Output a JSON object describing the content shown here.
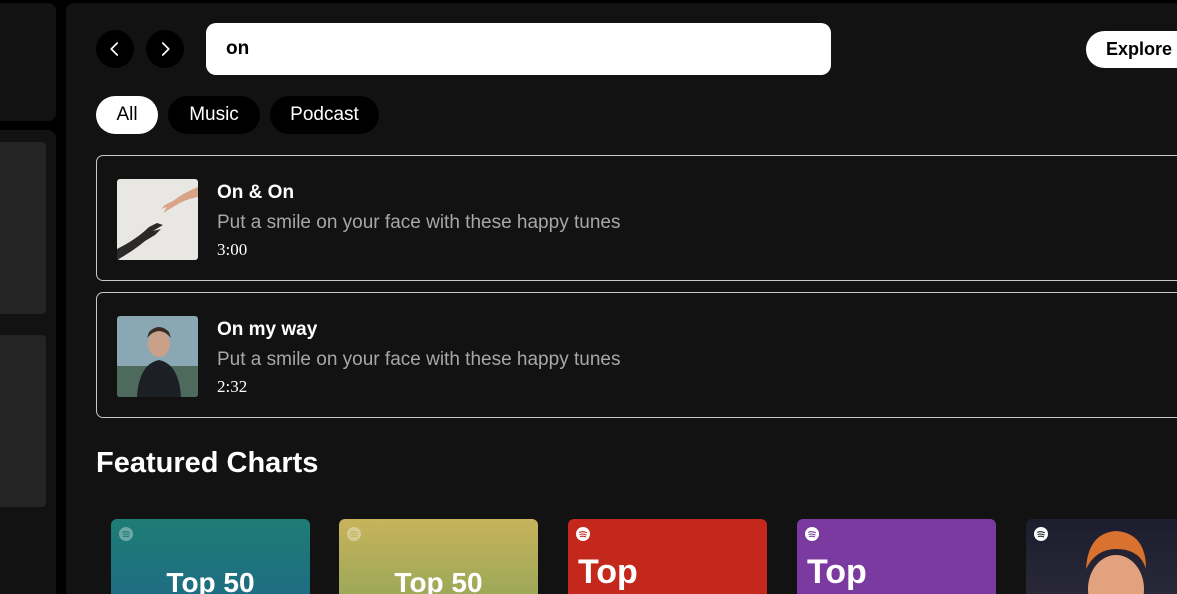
{
  "nav": {
    "back_icon": "chevron-left-icon",
    "forward_icon": "chevron-right-icon"
  },
  "search": {
    "value": "on"
  },
  "explore_button": "Explore p",
  "filters": [
    {
      "label": "All",
      "active": true
    },
    {
      "label": "Music",
      "active": false
    },
    {
      "label": "Podcast",
      "active": false
    }
  ],
  "results": [
    {
      "title": "On & On",
      "subtitle": "Put a smile on your face with these happy tunes",
      "duration": "3:00"
    },
    {
      "title": "On my way",
      "subtitle": "Put a smile on your face with these happy tunes",
      "duration": "2:32"
    }
  ],
  "featured": {
    "title": "Featured Charts",
    "cards": [
      {
        "label": "Top 50",
        "color": "#1e7c74"
      },
      {
        "label": "Top 50",
        "color": "#c8b35b"
      },
      {
        "label": "Top",
        "color": "#c4271b"
      },
      {
        "label": "Top",
        "color": "#7b3aa0"
      },
      {
        "label": "",
        "color": "#1c1d2e"
      }
    ]
  },
  "colors": {
    "background": "#000000",
    "panel": "#121212",
    "muted_text": "#a7a7a7"
  }
}
